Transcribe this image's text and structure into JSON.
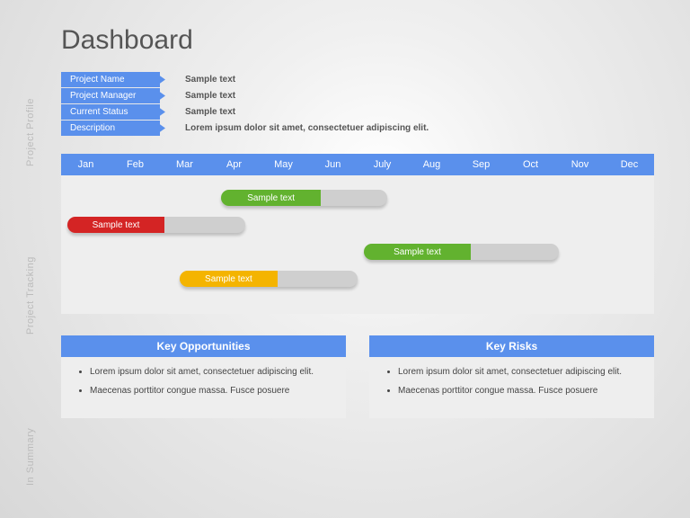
{
  "title": "Dashboard",
  "section_labels": {
    "profile": "Project Profile",
    "tracking": "Project Tracking",
    "summary": "In Summary"
  },
  "profile": {
    "rows": [
      {
        "label": "Project Name",
        "value": "Sample text"
      },
      {
        "label": "Project Manager",
        "value": "Sample text"
      },
      {
        "label": "Current Status",
        "value": "Sample text"
      },
      {
        "label": "Description",
        "value": "Lorem ipsum dolor sit amet, consectetuer adipiscing elit."
      }
    ]
  },
  "chart_data": {
    "type": "bar",
    "categories": [
      "Jan",
      "Feb",
      "Mar",
      "Apr",
      "May",
      "Jun",
      "July",
      "Aug",
      "Sep",
      "Oct",
      "Nov",
      "Dec"
    ],
    "title": "",
    "xlabel": "",
    "ylabel": "",
    "series": [
      {
        "name": "Sample text",
        "start": "Jan",
        "end": "Apr",
        "progress_end": "Feb",
        "color": "#d42424",
        "row": 1
      },
      {
        "name": "Sample text",
        "start": "Apr",
        "end": "July",
        "progress_end": "Jun",
        "color": "#62b22f",
        "row": 0
      },
      {
        "name": "Sample text",
        "start": "Mar",
        "end": "Jun",
        "progress_end": "May",
        "color": "#f4b400",
        "row": 3
      },
      {
        "name": "Sample text",
        "start": "July",
        "end": "Nov",
        "progress_end": "Sep",
        "color": "#62b22f",
        "row": 2
      }
    ]
  },
  "summary": {
    "opportunities": {
      "title": "Key Opportunities",
      "items": [
        "Lorem ipsum dolor sit amet, consectetuer adipiscing elit.",
        "Maecenas porttitor congue massa. Fusce posuere"
      ]
    },
    "risks": {
      "title": "Key Risks",
      "items": [
        "Lorem ipsum dolor sit amet, consectetuer adipiscing elit.",
        "Maecenas porttitor congue massa. Fusce posuere"
      ]
    }
  }
}
